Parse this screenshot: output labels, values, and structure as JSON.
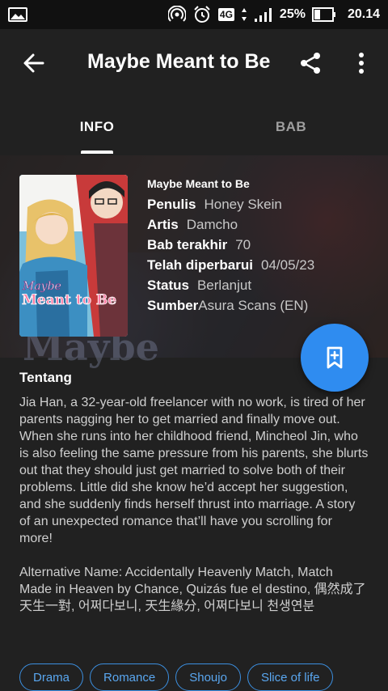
{
  "status_bar": {
    "battery": "25%",
    "time": "20.14",
    "network": "4G"
  },
  "toolbar": {
    "title": "Maybe Meant to Be"
  },
  "tabs": [
    {
      "label": "INFO"
    },
    {
      "label": "BAB"
    }
  ],
  "manga": {
    "title": "Maybe Meant to Be",
    "cover_lines": [
      "Maybe",
      "Meant to Be"
    ],
    "details": [
      {
        "key": "Penulis",
        "value": "Honey Skein"
      },
      {
        "key": "Artis",
        "value": "Damcho"
      },
      {
        "key": "Bab terakhir",
        "value": "70"
      },
      {
        "key": "Telah diperbarui",
        "value": "04/05/23"
      },
      {
        "key": "Status",
        "value": "Berlanjut"
      },
      {
        "key": "Sumber",
        "value": "Asura Scans (EN)"
      }
    ]
  },
  "about": {
    "heading": "Tentang",
    "description": "Jia Han, a 32-year-old freelancer with no work, is tired of her parents nagging her to get married and finally move out. When she runs into her childhood friend, Mincheol Jin, who is also feeling the same pressure from his parents, she blurts out that they should just get married to solve both of their problems. Little did she know he’d accept her suggestion, and she suddenly finds herself thrust into marriage. A story of an unexpected romance that’ll have you scrolling for more!",
    "alt_names": "Alternative Name: Accidentally Heavenly Match, Match Made in Heaven by Chance, Quizás fue el destino, 偶然成了天生一對, 어쩌다보니, 天生緣分, 어쩌다보니 천생연분"
  },
  "genres": [
    "Drama",
    "Romance",
    "Shoujo",
    "Slice of life"
  ],
  "icons": {
    "back": "arrow-back-icon",
    "share": "share-icon",
    "more": "more-vert-icon",
    "fab": "bookmark-add-icon"
  },
  "colors": {
    "accent": "#2f8cf0",
    "chip": "#5aa7f0",
    "background": "#212121"
  }
}
